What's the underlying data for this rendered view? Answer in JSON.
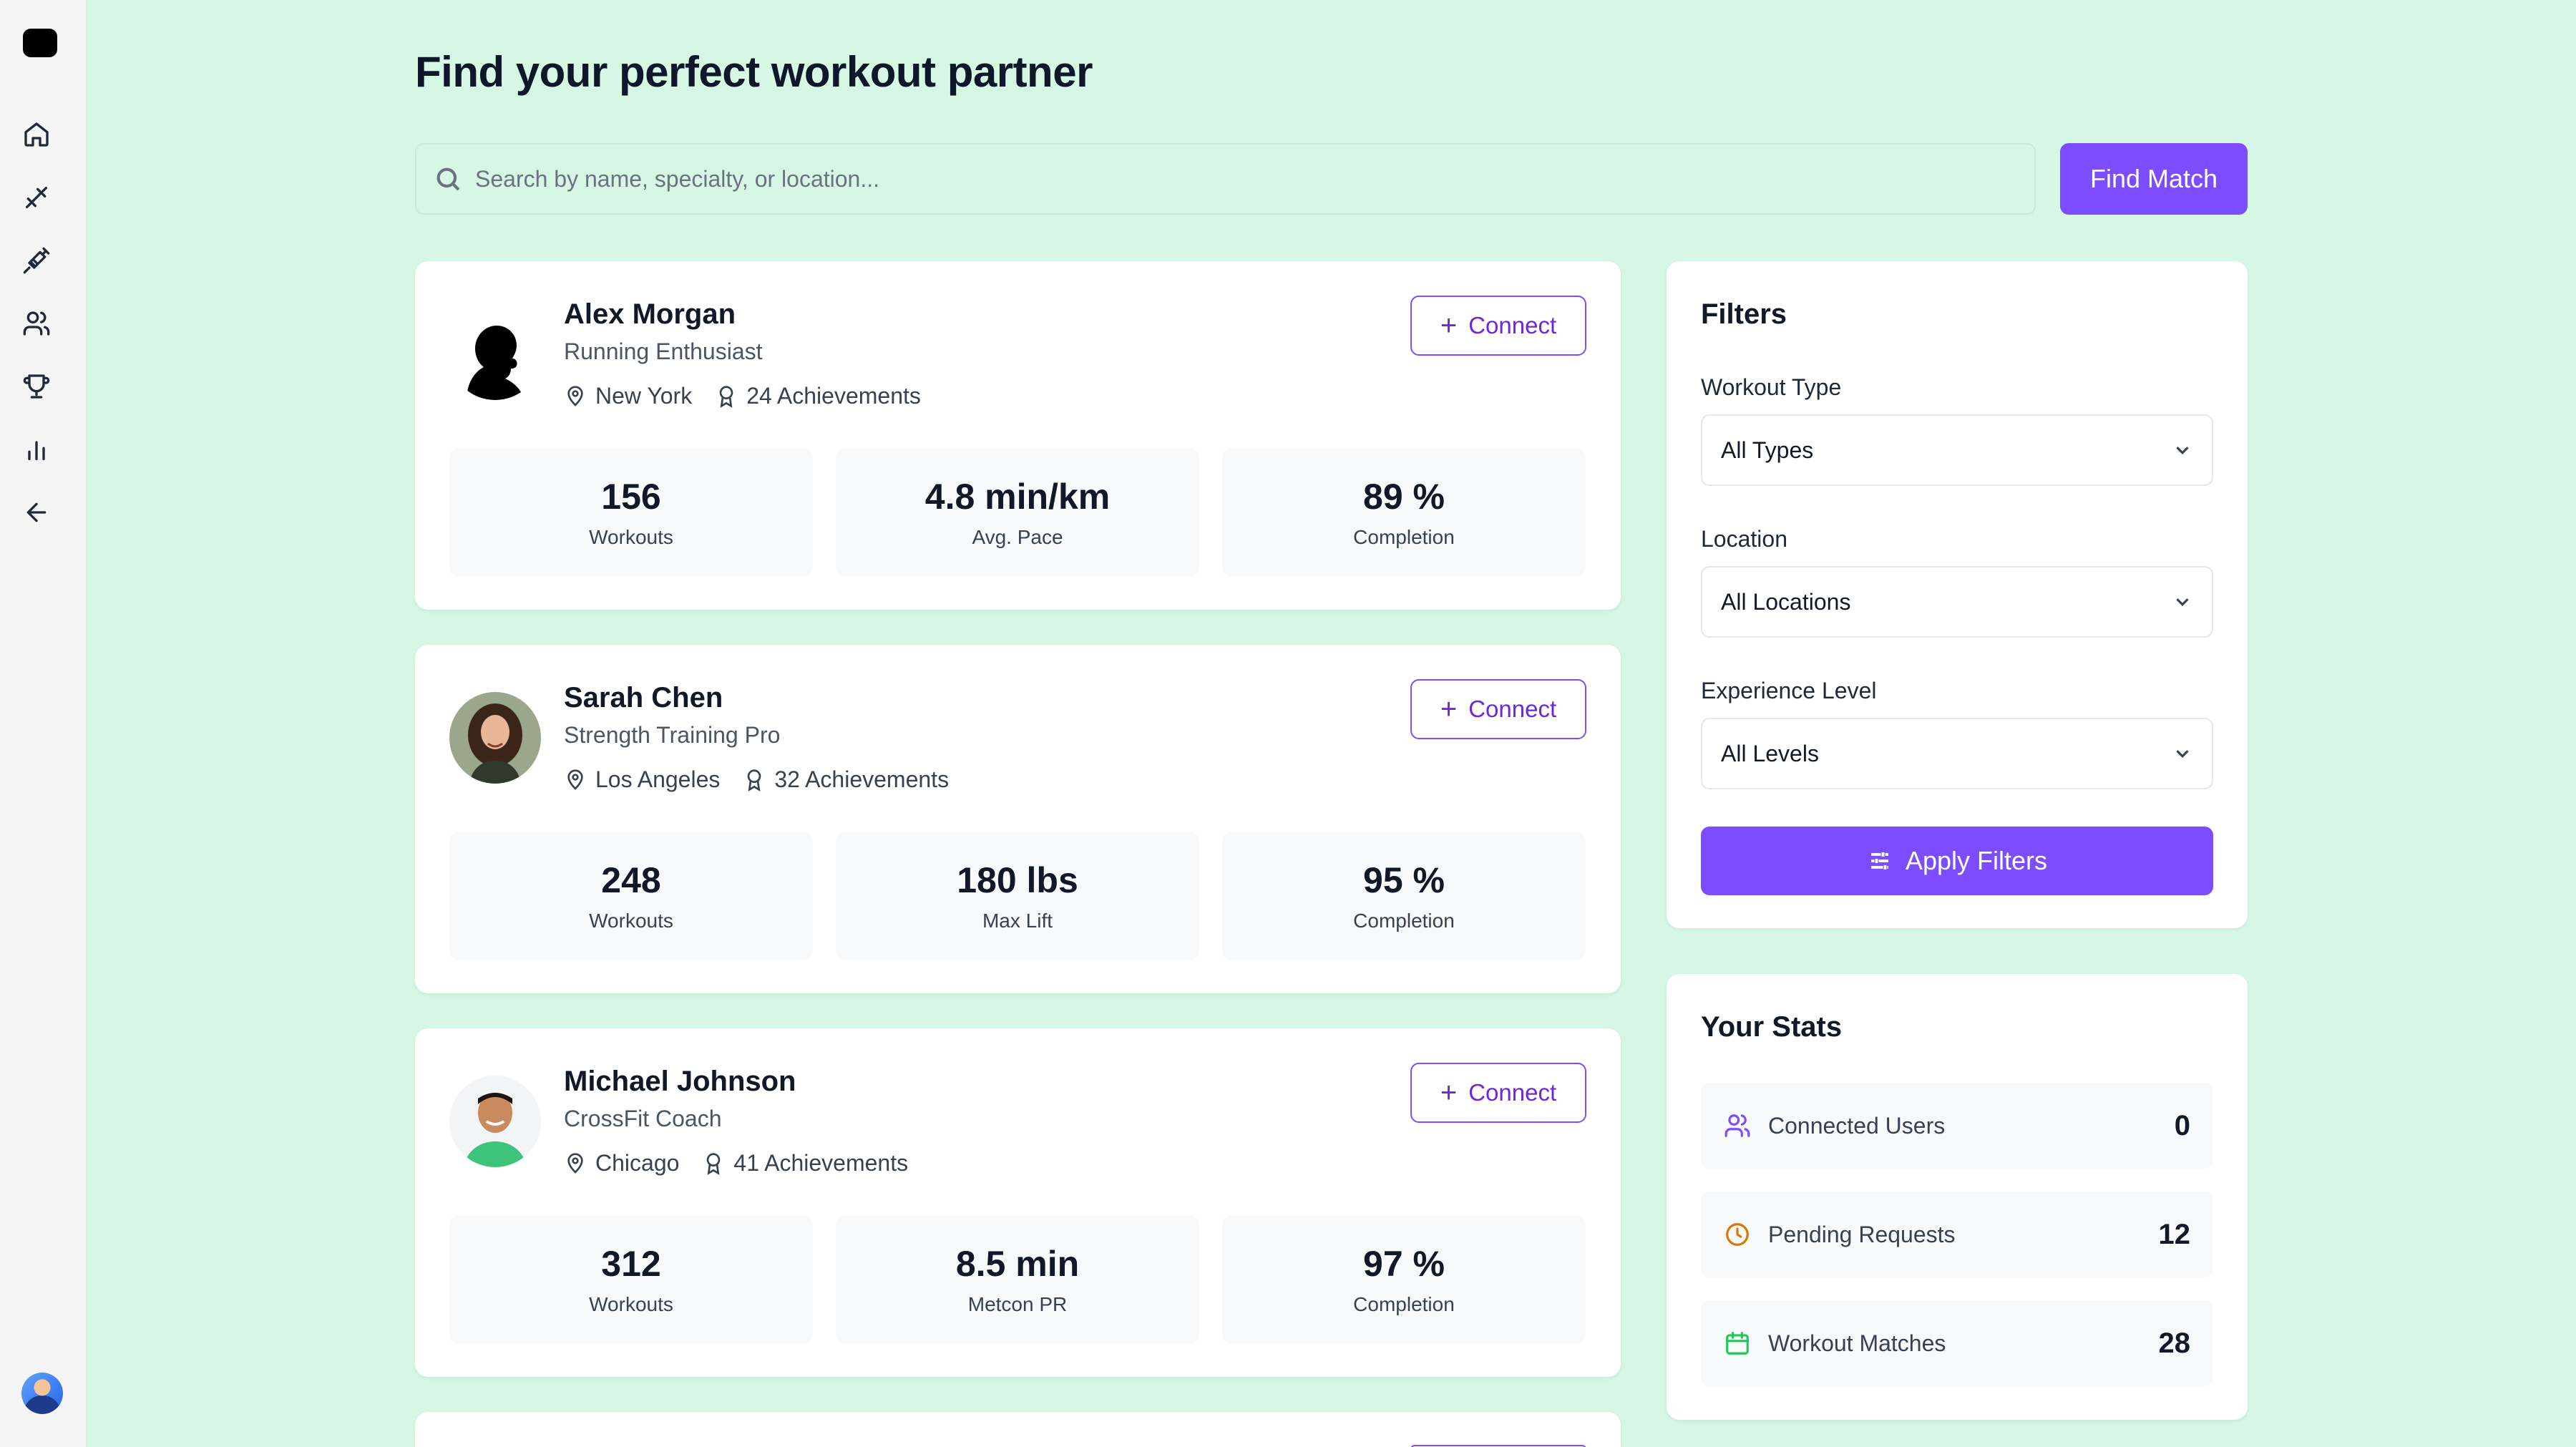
{
  "sidebar": {
    "items": [
      {
        "icon": "home-icon",
        "name": "home"
      },
      {
        "icon": "dumbbell-icon",
        "name": "workouts"
      },
      {
        "icon": "syringe-icon",
        "name": "nutrition"
      },
      {
        "icon": "users-icon",
        "name": "partners"
      },
      {
        "icon": "trophy-icon",
        "name": "achievements"
      },
      {
        "icon": "bar-chart-icon",
        "name": "stats"
      },
      {
        "icon": "arrow-left-icon",
        "name": "back"
      }
    ]
  },
  "header": {
    "title": "Find your perfect workout partner",
    "search_placeholder": "Search by name, specialty, or location...",
    "find_button": "Find Match"
  },
  "partners": [
    {
      "name": "Alex Morgan",
      "role": "Running Enthusiast",
      "location": "New York",
      "achievements": "24 Achievements",
      "connect_label": "Connect",
      "stats": [
        {
          "value": "156",
          "label": "Workouts"
        },
        {
          "value": "4.8 min/km",
          "label": "Avg. Pace"
        },
        {
          "value": "89 %",
          "label": "Completion"
        }
      ]
    },
    {
      "name": "Sarah Chen",
      "role": "Strength Training Pro",
      "location": "Los Angeles",
      "achievements": "32 Achievements",
      "connect_label": "Connect",
      "stats": [
        {
          "value": "248",
          "label": "Workouts"
        },
        {
          "value": "180 lbs",
          "label": "Max Lift"
        },
        {
          "value": "95 %",
          "label": "Completion"
        }
      ]
    },
    {
      "name": "Michael Johnson",
      "role": "CrossFit Coach",
      "location": "Chicago",
      "achievements": "41 Achievements",
      "connect_label": "Connect",
      "stats": [
        {
          "value": "312",
          "label": "Workouts"
        },
        {
          "value": "8.5 min",
          "label": "Metcon PR"
        },
        {
          "value": "97 %",
          "label": "Completion"
        }
      ]
    }
  ],
  "filters": {
    "title": "Filters",
    "workout_type_label": "Workout Type",
    "workout_type_value": "All Types",
    "location_label": "Location",
    "location_value": "All Locations",
    "experience_label": "Experience Level",
    "experience_value": "All Levels",
    "apply_label": "Apply Filters"
  },
  "your_stats": {
    "title": "Your Stats",
    "rows": [
      {
        "label": "Connected Users",
        "value": "0",
        "icon": "users-icon",
        "color": "#7c4dff"
      },
      {
        "label": "Pending Requests",
        "value": "12",
        "icon": "clock-icon",
        "color": "#d97706"
      },
      {
        "label": "Workout Matches",
        "value": "28",
        "icon": "calendar-icon",
        "color": "#22c55e"
      }
    ]
  },
  "colors": {
    "accent": "#7c4dff",
    "background": "#d5f7e4"
  }
}
